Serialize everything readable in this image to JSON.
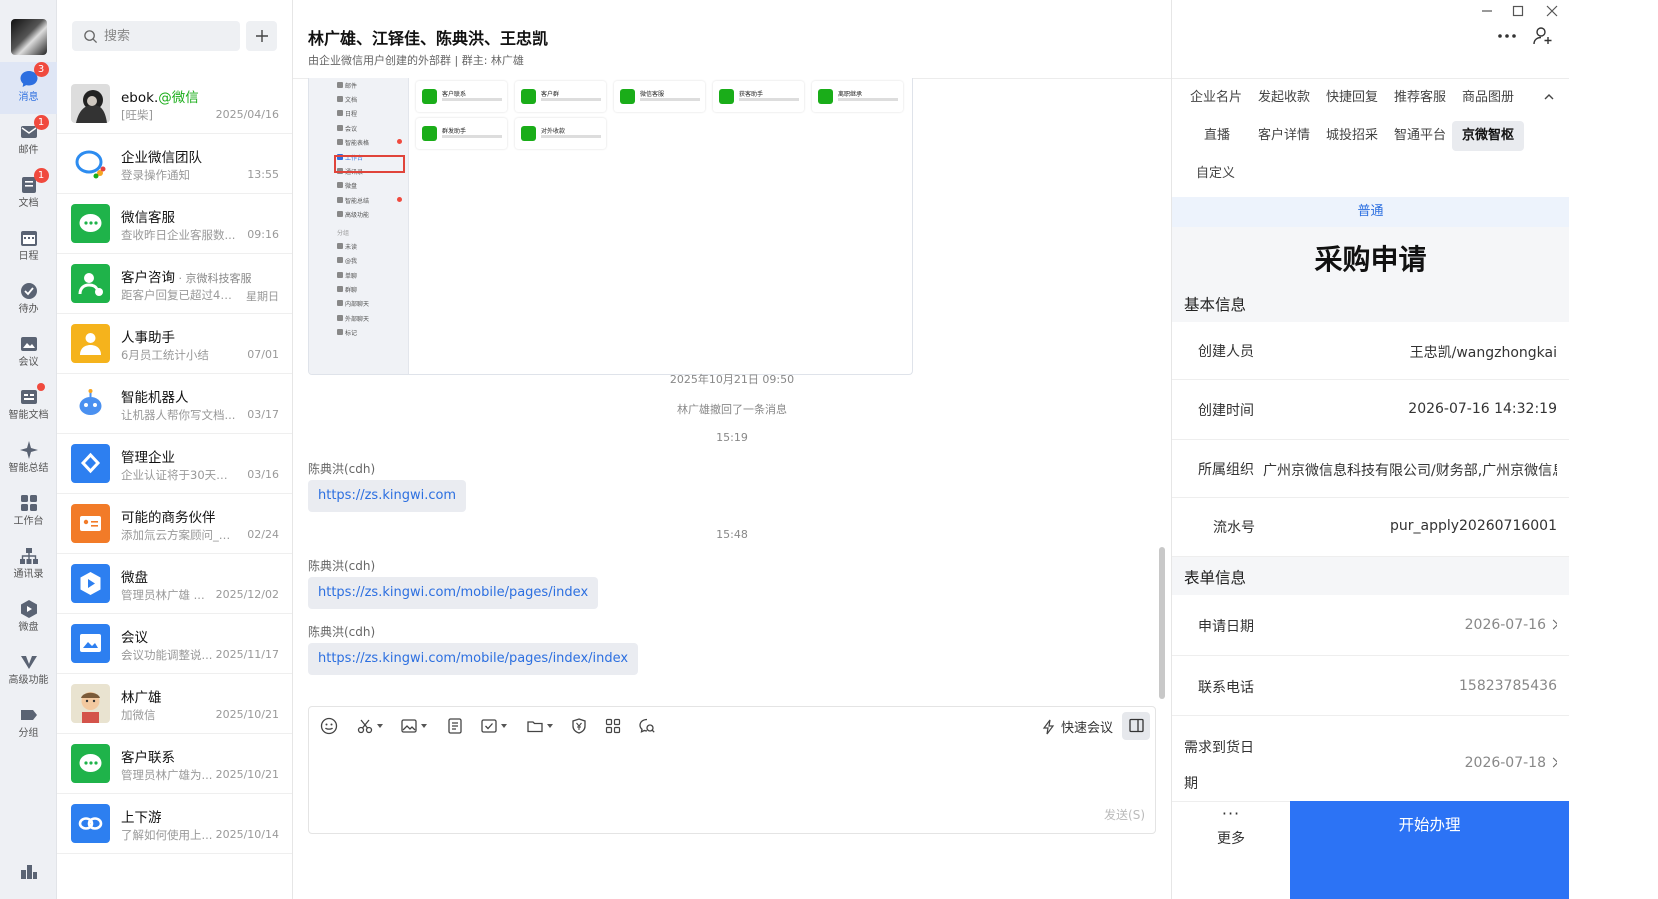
{
  "rail": {
    "items": [
      {
        "label": "消息",
        "badge": "3"
      },
      {
        "label": "邮件",
        "badge": "1"
      },
      {
        "label": "文档",
        "badge": "1"
      },
      {
        "label": "日程"
      },
      {
        "label": "待办"
      },
      {
        "label": "会议"
      },
      {
        "label": "智能文档"
      },
      {
        "label": "智能总结"
      },
      {
        "label": "工作台"
      },
      {
        "label": "通讯录"
      },
      {
        "label": "微盘"
      },
      {
        "label": "高级功能"
      },
      {
        "label": "分组"
      }
    ]
  },
  "search": {
    "placeholder": "搜索"
  },
  "conversations": [
    {
      "name": "ebok.",
      "name_suffix": "@微信",
      "preview": "[旺柴]",
      "time": "2025/04/16"
    },
    {
      "name": "企业微信团队",
      "preview": "登录操作通知",
      "time": "13:55"
    },
    {
      "name": "微信客服",
      "preview": "查收昨日企业客服数...",
      "time": "09:16"
    },
    {
      "name": "客户咨询",
      "name_tag": " · 京微科技客服",
      "preview": "距客户回复已超过48...",
      "time": "星期日"
    },
    {
      "name": "人事助手",
      "preview": "6月员工统计小结",
      "time": "07/01"
    },
    {
      "name": "智能机器人",
      "preview": "让机器人帮你写文档...",
      "time": "03/17"
    },
    {
      "name": "管理企业",
      "preview": "企业认证将于30天后...",
      "time": "03/16"
    },
    {
      "name": "可能的商务伙伴",
      "preview": "添加氚云方案顾问_智...",
      "time": "02/24"
    },
    {
      "name": "微盘",
      "preview": "管理员林广雄 ...",
      "time": "2025/12/02"
    },
    {
      "name": "会议",
      "preview": "会议功能调整说...",
      "time": "2025/11/17"
    },
    {
      "name": "林广雄",
      "preview": "加微信",
      "time": "2025/10/21"
    },
    {
      "name": "客户联系",
      "preview": "管理员林广雄为...",
      "time": "2025/10/21"
    },
    {
      "name": "上下游",
      "preview": "了解如何使用上...",
      "time": "2025/10/14"
    }
  ],
  "chat": {
    "title": "林广雄、江铎佳、陈典洪、王忠凯",
    "subtitle": "由企业微信用户创建的外部群 | 群主: 林广雄",
    "screenshot": {
      "sidebar": [
        "邮件",
        "文档",
        "日程",
        "会议",
        "智能表格",
        "工作台",
        "通讯录",
        "微盘",
        "智能总结",
        "高级功能",
        "分组",
        "未读",
        "@我",
        "单聊",
        "群聊",
        "内部聊天",
        "外部聊天",
        "标记"
      ],
      "cards": [
        "客户联系",
        "客户群",
        "微信客服",
        "获客助手",
        "离职继承",
        "群发助手",
        "对外收款"
      ]
    },
    "messages": {
      "t1": "2025年10月21日 09:50",
      "recall": "林广雄撤回了一条消息",
      "t2": "15:19",
      "s1": "陈典洪(cdh)",
      "l1": "https://zs.kingwi.com",
      "t3": "15:48",
      "s2": "陈典洪(cdh)",
      "l2": "https://zs.kingwi.com/mobile/pages/index",
      "s3": "陈典洪(cdh)",
      "l3": "https://zs.kingwi.com/mobile/pages/index/index"
    },
    "composer": {
      "quick_meeting": "快速会议",
      "send": "发送(S)"
    }
  },
  "panel": {
    "tabs": [
      "企业名片",
      "发起收款",
      "快捷回复",
      "推荐客服",
      "商品图册",
      "直播",
      "客户详情",
      "城投招采",
      "智通平台",
      "京微智枢",
      "自定义"
    ],
    "selected_tab": "京微智枢",
    "form": {
      "banner": "普通",
      "title": "采购申请",
      "section1": "基本信息",
      "creator_label": "创建人员",
      "creator": "王忠凯/wangzhongkai",
      "ctime_label": "创建时间",
      "ctime": "2026-07-16 14:32:19",
      "org_label": "所属组织",
      "org": "广州京微信息科技有限公司/财务部,广州京微信息科技有限公司",
      "serial_label": "流水号",
      "serial": "pur_apply20260716001",
      "section2": "表单信息",
      "apply_date_label": "申请日期",
      "apply_date": "2026-07-16",
      "phone_label": "联系电话",
      "phone": "15823785436",
      "due_label_1": "需求到货日",
      "due_label_2": "期",
      "due": "2026-07-18"
    },
    "footer": {
      "more": "更多",
      "start": "开始办理"
    }
  },
  "colors": {
    "accent": "#2c73f5",
    "badge": "#f04a3e",
    "link": "#2c6fe0"
  }
}
